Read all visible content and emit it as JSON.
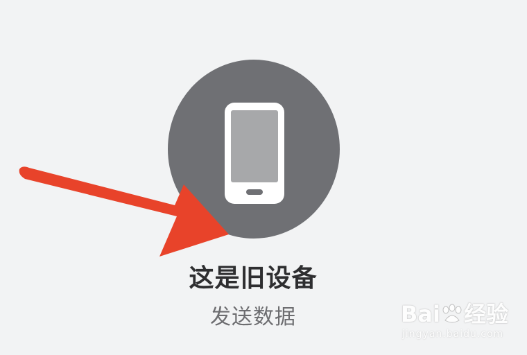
{
  "device_option": {
    "title": "这是旧设备",
    "subtitle": "发送数据",
    "icon": "phone-icon"
  },
  "annotation": {
    "icon": "red-arrow-icon",
    "color": "#e8432a"
  },
  "watermark": {
    "brand_prefix": "Bai",
    "brand_suffix": "经验",
    "url": "jingyan.baidu.com"
  },
  "colors": {
    "background": "#f2f3f4",
    "circle": "#6f7074",
    "phone_body": "#ffffff",
    "phone_screen": "#a7a8aa"
  }
}
